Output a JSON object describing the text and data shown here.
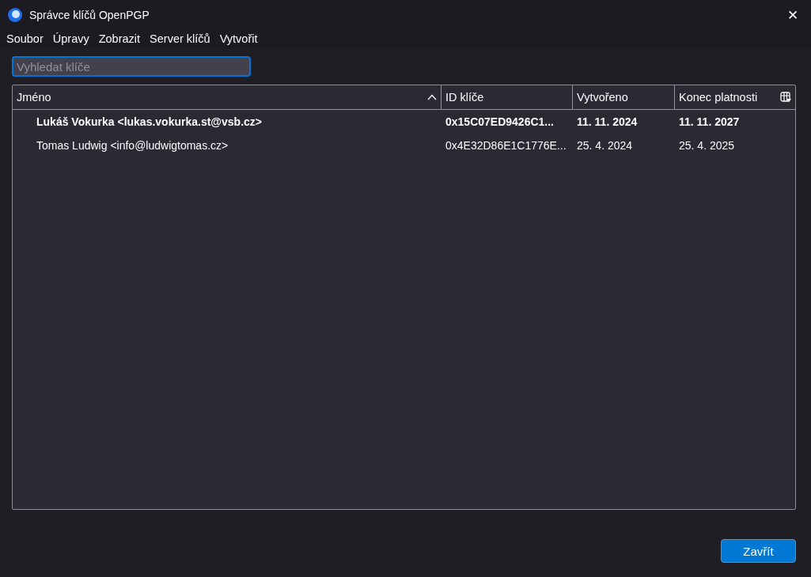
{
  "window": {
    "title": "Správce klíčů OpenPGP",
    "close": "✕"
  },
  "menu": [
    "Soubor",
    "Úpravy",
    "Zobrazit",
    "Server klíčů",
    "Vytvořit"
  ],
  "search": {
    "placeholder": "Vyhledat klíče"
  },
  "table": {
    "columns": [
      {
        "label": "Jméno",
        "sorted": true
      },
      {
        "label": "ID klíče",
        "sorted": false
      },
      {
        "label": "Vytvořeno",
        "sorted": false
      },
      {
        "label": "Konec platnosti",
        "sorted": false
      }
    ],
    "rows": [
      {
        "bold": true,
        "cells": [
          "Lukáš Vokurka <lukas.vokurka.st@vsb.cz>",
          "0x15C07ED9426C1...",
          "11. 11. 2024",
          "11. 11. 2027"
        ]
      },
      {
        "bold": false,
        "cells": [
          "Tomas Ludwig <info@ludwigtomas.cz>",
          "0x4E32D86E1C1776E...",
          "25. 4. 2024",
          "25. 4. 2025"
        ]
      }
    ]
  },
  "buttons": [
    "Zavřít"
  ]
}
